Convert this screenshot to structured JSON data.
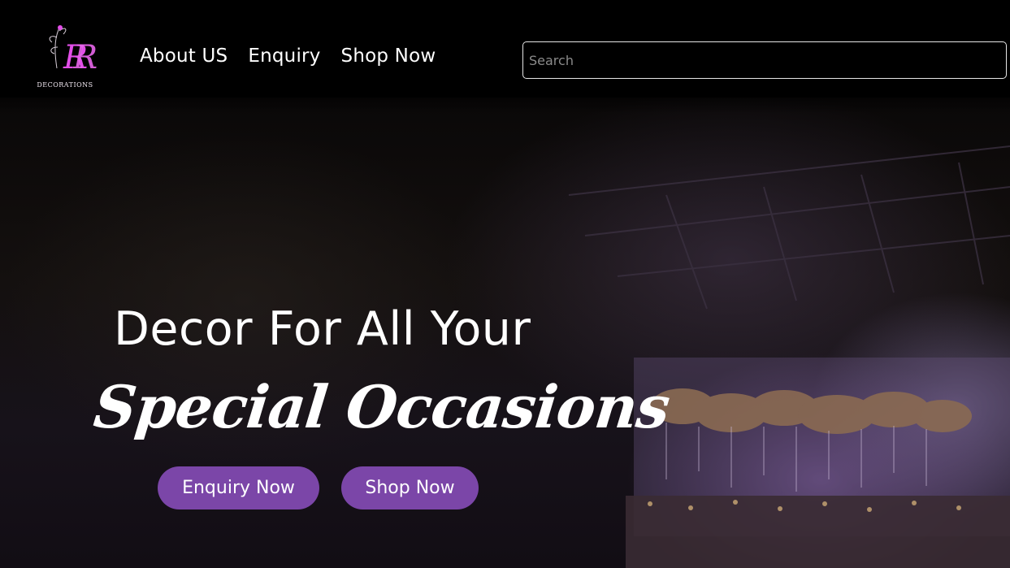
{
  "brand": {
    "logo_monogram": "RR",
    "logo_text": "DECORATIONS",
    "accent_color": "#e24ee8"
  },
  "nav": {
    "items": [
      {
        "label": "About US"
      },
      {
        "label": "Enquiry"
      },
      {
        "label": "Shop Now"
      }
    ]
  },
  "search": {
    "placeholder": "Search",
    "value": ""
  },
  "hero": {
    "headline": "Decor For All Your",
    "script_text": "Special Occasions",
    "background_image": "event-venue-photo",
    "buttons": {
      "enquiry_label": "Enquiry Now",
      "shop_label": "Shop Now"
    },
    "button_color": "#7b46a8"
  }
}
